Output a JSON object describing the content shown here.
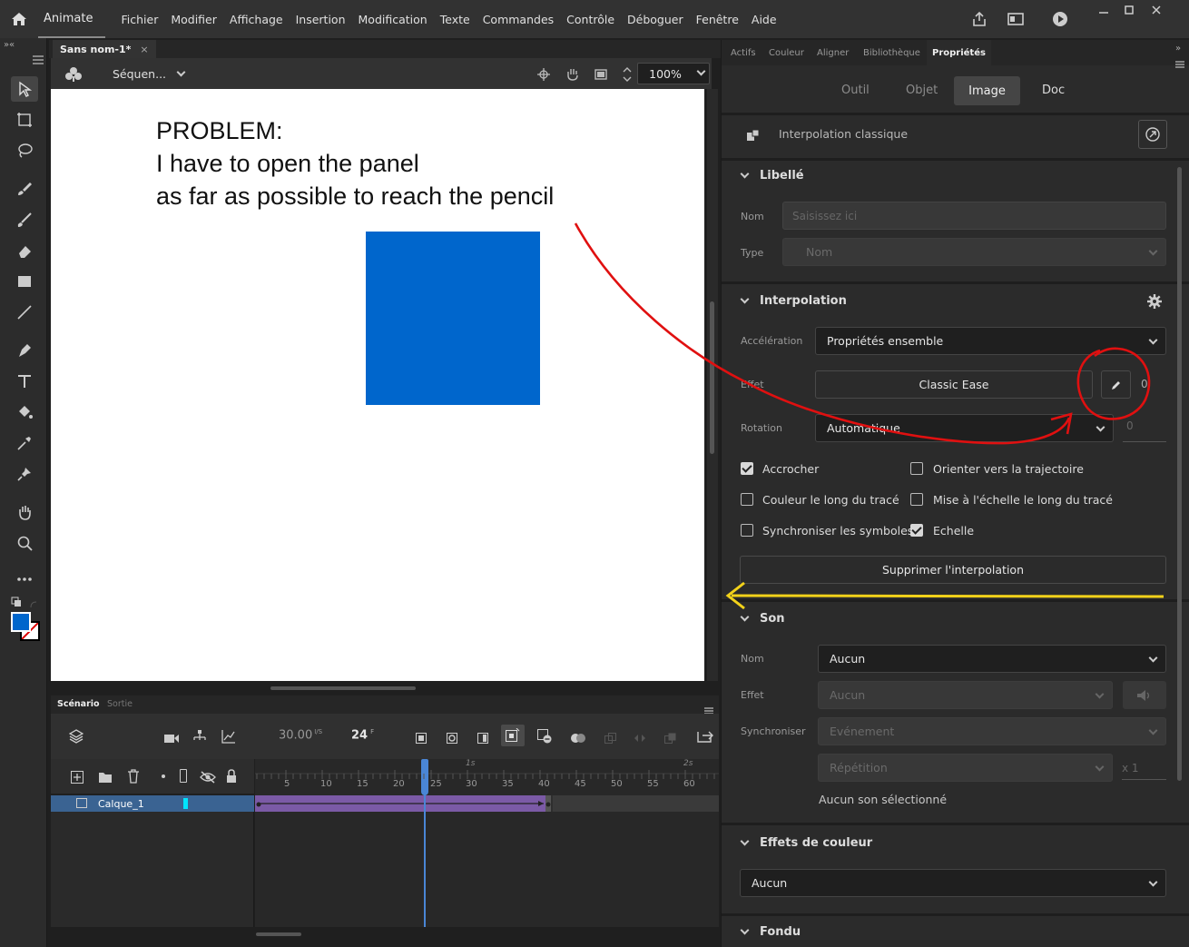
{
  "app": {
    "name": "Animate"
  },
  "menu": [
    "Fichier",
    "Modifier",
    "Affichage",
    "Insertion",
    "Modification",
    "Texte",
    "Commandes",
    "Contrôle",
    "Déboguer",
    "Fenêtre",
    "Aide"
  ],
  "document": {
    "tab_name": "Sans nom-1*",
    "scene": "Séquen...",
    "zoom": "100%"
  },
  "stage": {
    "annotation_lines": [
      "PROBLEM:",
      "I have to open the panel",
      "as far as possible to reach the pencil"
    ],
    "square_color": "#0066cc"
  },
  "timeline": {
    "tabs": [
      "Scénario",
      "Sortie"
    ],
    "fps": "30.00",
    "fps_unit": "I/S",
    "frame": "24",
    "frame_unit": "F",
    "second_marks": [
      "1s",
      "2s"
    ],
    "frame_numbers": [
      "5",
      "10",
      "15",
      "20",
      "25",
      "30",
      "35",
      "40",
      "45",
      "50",
      "55",
      "60"
    ],
    "layer_name": "Calque_1"
  },
  "panel_tabs": [
    "Actifs",
    "Couleur",
    "Aligner",
    "Bibliothèque",
    "Propriétés"
  ],
  "prop_tabs": [
    "Outil",
    "Objet",
    "Image",
    "Doc"
  ],
  "object_type": "Interpolation classique",
  "libelle": {
    "header": "Libellé",
    "name_label": "Nom",
    "name_placeholder": "Saisissez ici",
    "type_label": "Type",
    "type_value": "Nom"
  },
  "interpolation": {
    "header": "Interpolation",
    "accel_label": "Accélération",
    "accel_value": "Propriétés ensemble",
    "effect_label": "Effet",
    "effect_value": "Classic Ease",
    "effect_num": "0",
    "rotation_label": "Rotation",
    "rotation_value": "Automatique",
    "rotation_num": "0",
    "checkboxes": [
      {
        "label": "Accrocher",
        "checked": true
      },
      {
        "label": "Orienter vers la trajectoire",
        "checked": false
      },
      {
        "label": "Couleur le long du tracé",
        "checked": false
      },
      {
        "label": "Mise à l'échelle le long du tracé",
        "checked": false
      },
      {
        "label": "Synchroniser les symboles",
        "checked": false
      },
      {
        "label": "Echelle",
        "checked": true
      }
    ],
    "remove_button": "Supprimer l'interpolation"
  },
  "son": {
    "header": "Son",
    "name_label": "Nom",
    "name_value": "Aucun",
    "effect_label": "Effet",
    "effect_value": "Aucun",
    "sync_label": "Synchroniser",
    "sync_value": "Evénement",
    "repeat_value": "Répétition",
    "repeat_count": "x 1",
    "status": "Aucun son sélectionné"
  },
  "color_effects": {
    "header": "Effets de couleur",
    "value": "Aucun"
  },
  "fondu": {
    "header": "Fondu"
  },
  "colors": {
    "accent_blue": "#0066cc",
    "layer_highlight": "#3a6392",
    "tween_purple": "#7b5aa6",
    "annotation_red": "#e01010",
    "annotation_yellow": "#f2d21a"
  }
}
